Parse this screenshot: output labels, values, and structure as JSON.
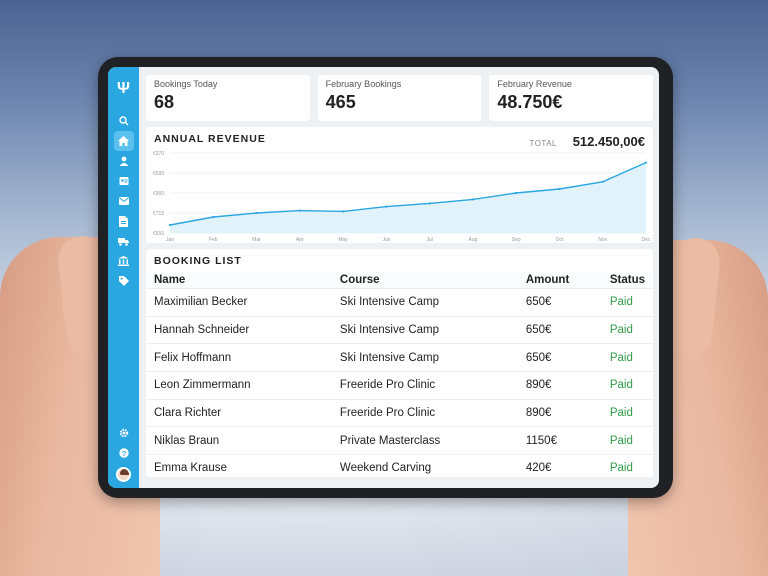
{
  "kpis": [
    {
      "label": "Bookings Today",
      "value": "68"
    },
    {
      "label": "February Bookings",
      "value": "465"
    },
    {
      "label": "February Revenue",
      "value": "48.750€"
    }
  ],
  "revenue": {
    "title": "ANNUAL REVENUE",
    "total_label": "TOTAL",
    "total_value": "512.450,00€"
  },
  "chart_data": {
    "type": "area",
    "title": "ANNUAL REVENUE",
    "xlabel": "",
    "ylabel": "",
    "categories": [
      "Jan",
      "Feb",
      "Mar",
      "Apr",
      "May",
      "Jun",
      "Jul",
      "Aug",
      "Sep",
      "Oct",
      "Nov",
      "Dec"
    ],
    "y_ticks": [
      "€650",
      "€715",
      "€900",
      "€595",
      "€370"
    ],
    "ylim": [
      0,
      100
    ],
    "series": [
      {
        "values": [
          10,
          20,
          25,
          28,
          27,
          33,
          37,
          42,
          50,
          55,
          64,
          88
        ]
      }
    ],
    "grid": true,
    "color": "#2aa7e0"
  },
  "booking_list": {
    "title": "BOOKING LIST",
    "columns": [
      "Name",
      "Course",
      "Amount",
      "Status"
    ],
    "rows": [
      [
        "Maximilian Becker",
        "Ski Intensive Camp",
        "650€",
        "Paid"
      ],
      [
        "Hannah Schneider",
        "Ski Intensive Camp",
        "650€",
        "Paid"
      ],
      [
        "Felix Hoffmann",
        "Ski Intensive Camp",
        "650€",
        "Paid"
      ],
      [
        "Leon Zimmermann",
        "Freeride Pro Clinic",
        "890€",
        "Paid"
      ],
      [
        "Clara Richter",
        "Freeride Pro Clinic",
        "890€",
        "Paid"
      ],
      [
        "Niklas Braun",
        "Private Masterclass",
        "1150€",
        "Paid"
      ],
      [
        "Emma Krause",
        "Weekend Carving",
        "420€",
        "Paid"
      ]
    ]
  },
  "sidebar": {
    "icons": [
      "search-icon",
      "home-icon",
      "user-icon",
      "contact-card-icon",
      "mail-icon",
      "document-icon",
      "truck-icon",
      "bank-icon",
      "tag-icon"
    ],
    "bottom_icons": [
      "gear-icon",
      "help-icon"
    ]
  },
  "colors": {
    "accent": "#2aa7e0",
    "paid": "#2f9b47"
  }
}
